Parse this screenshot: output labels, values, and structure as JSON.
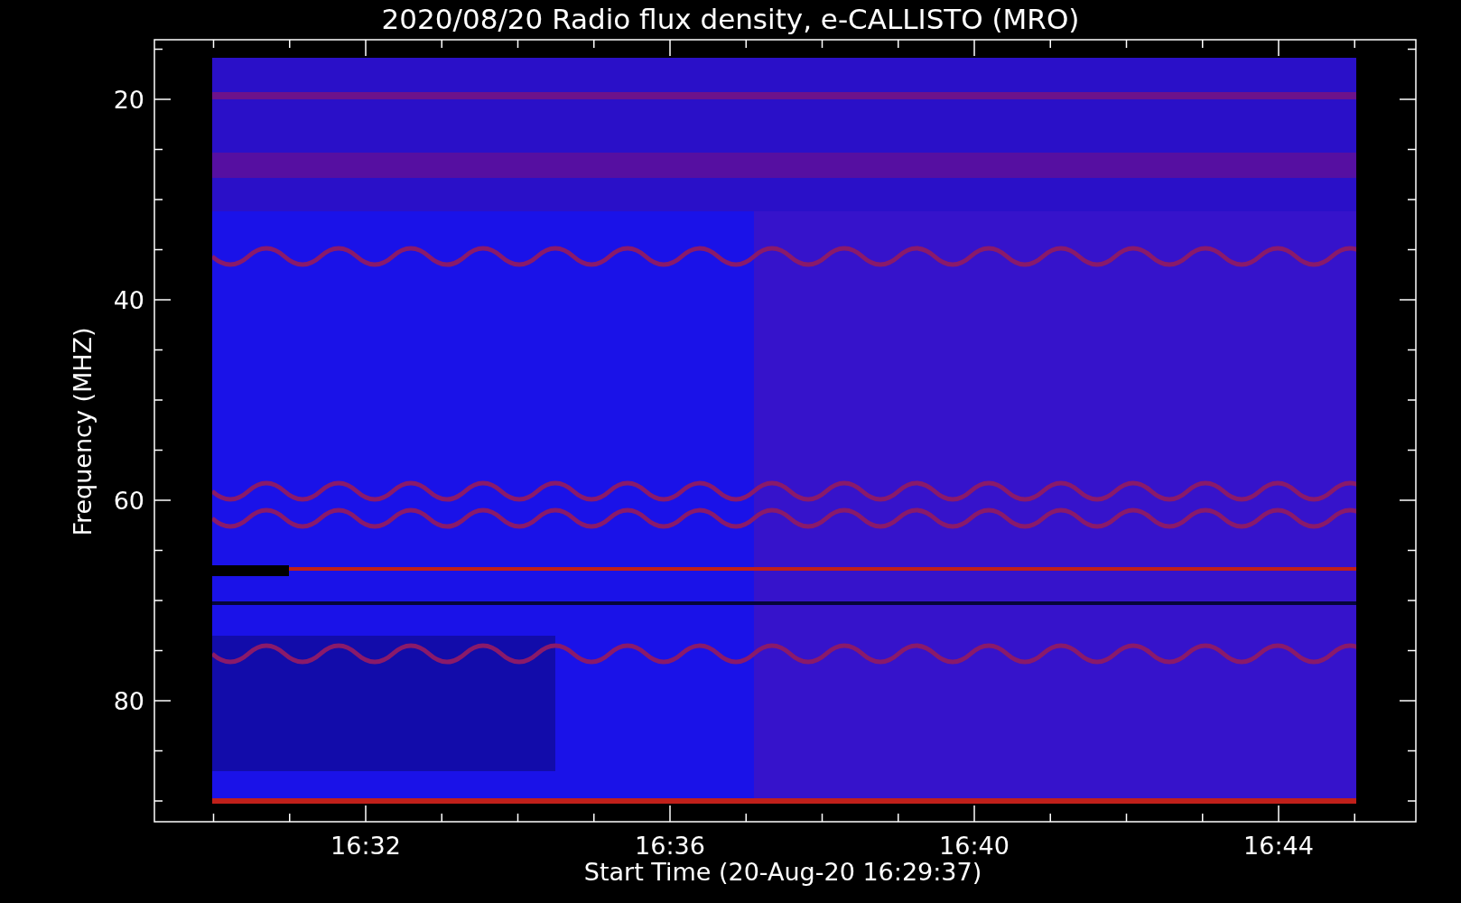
{
  "title": "2020/08/20  Radio flux density, e-CALLISTO (MRO)",
  "y_axis": {
    "label": "Frequency (MHZ)",
    "ticks": [
      "20",
      "40",
      "60",
      "80"
    ]
  },
  "x_axis": {
    "label": "Start Time (20-Aug-20 16:29:37)",
    "ticks": [
      "16:32",
      "16:36",
      "16:40",
      "16:44"
    ]
  }
}
